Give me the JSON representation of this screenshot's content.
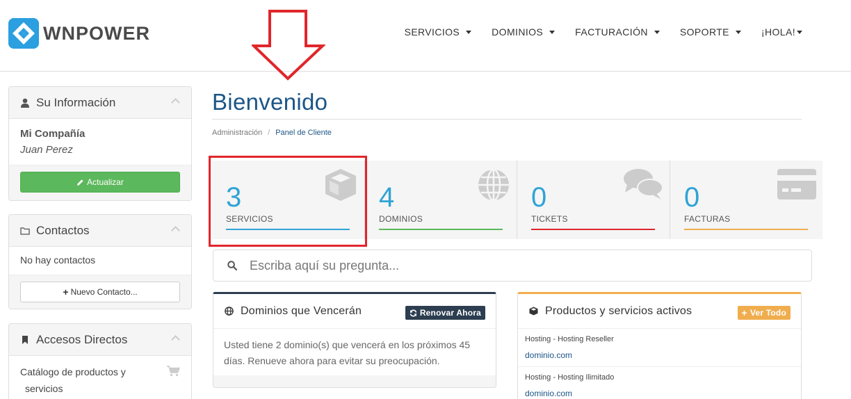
{
  "brand": {
    "name": "WNPOWER"
  },
  "nav": {
    "items": [
      {
        "label": "SERVICIOS",
        "dropdown": true
      },
      {
        "label": "DOMINIOS",
        "dropdown": true
      },
      {
        "label": "FACTURACIÓN",
        "dropdown": true
      },
      {
        "label": "SOPORTE",
        "dropdown": true
      },
      {
        "label": "¡HOLA!",
        "dropdown": true
      }
    ]
  },
  "sidebar": {
    "info": {
      "title": "Su Información",
      "company": "Mi Compañía",
      "name": "Juan Perez",
      "button": "Actualizar"
    },
    "contacts": {
      "title": "Contactos",
      "empty": "No hay contactos",
      "button": "Nuevo Contacto..."
    },
    "shortcuts": {
      "title": "Accesos Directos",
      "items": [
        {
          "label": "Catálogo de productos y servicios",
          "icon": "cart-icon"
        }
      ]
    }
  },
  "main": {
    "title": "Bienvenido",
    "breadcrumb": [
      "Administración",
      "Panel de Cliente"
    ],
    "tiles": [
      {
        "count": "3",
        "label": "SERVICIOS",
        "color": "#2fa4d6",
        "icon": "cube-icon"
      },
      {
        "count": "4",
        "label": "DOMINIOS",
        "color": "#5cb85c",
        "icon": "globe-icon"
      },
      {
        "count": "0",
        "label": "TICKETS",
        "color": "#e0262b",
        "icon": "comments-icon"
      },
      {
        "count": "0",
        "label": "FACTURAS",
        "color": "#f0ad4e",
        "icon": "credit-card-icon"
      }
    ],
    "search": {
      "placeholder": "Escriba aquí su pregunta..."
    },
    "domains_card": {
      "title": "Dominios que Vencerán",
      "button": "Renovar Ahora",
      "text": "Usted tiene 2 dominio(s) que vencerá en los próximos 45 días. Renueve ahora para evitar su preocupación."
    },
    "products_card": {
      "title": "Productos y servicios activos",
      "button": "Ver Todo",
      "items": [
        {
          "name": "Hosting - Hosting Reseller",
          "domain": "dominio.com"
        },
        {
          "name": "Hosting - Hosting Ilimitado",
          "domain": "dominio.com"
        }
      ]
    }
  },
  "colors": {
    "accent_blue": "#1c5587",
    "annotation_red": "#e0262b",
    "header_btn_dark": "#2c3e50",
    "header_btn_orange": "#f0ad4e"
  }
}
